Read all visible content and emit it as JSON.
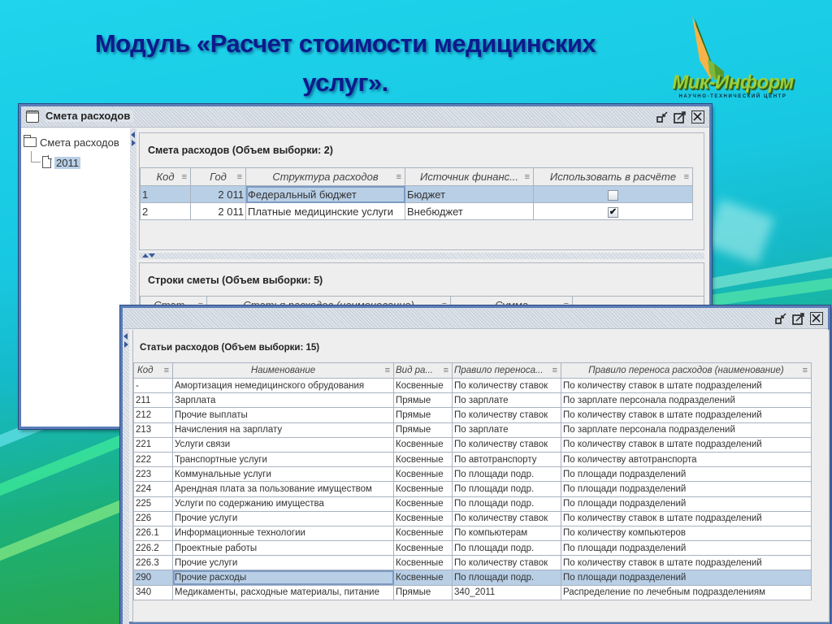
{
  "slide": {
    "title_line1": "Модуль «Расчет стоимости медицинских",
    "title_line2": "услуг».",
    "logo_name": "Мик-Информ",
    "logo_tagline": "НАУЧНО-ТЕХНИЧЕСКИЙ ЦЕНТР"
  },
  "window1": {
    "title": "Смета расходов",
    "tree": {
      "root": "Смета расходов",
      "child": "2011"
    },
    "panel1": {
      "title": "Смета расходов (Объем выборки: 2)",
      "columns": [
        "Код",
        "Год",
        "Структура расходов",
        "Источник финанс...",
        "Использовать в расчёте"
      ],
      "rows": [
        {
          "code": "1",
          "year": "2 011",
          "structure": "Федеральный бюджет",
          "source": "Бюджет",
          "use": false
        },
        {
          "code": "2",
          "year": "2 011",
          "structure": "Платные медицинские услуги",
          "source": "Внебюджет",
          "use": true
        }
      ],
      "selected_row": 0
    },
    "panel2": {
      "title": "Строки сметы (Объем выборки: 5)",
      "columns": [
        "Стат...",
        "Статья расходов (наименование)",
        "Сумма",
        ""
      ]
    }
  },
  "window2": {
    "panel": {
      "title": "Статьи расходов (Объем выборки: 15)",
      "columns": [
        "Код",
        "Наименование",
        "Вид ра...",
        "Правило переноса...",
        "Правило переноса расходов (наименование)"
      ],
      "rows": [
        [
          "-",
          "Амортизация немедицинского обрудования",
          "Косвенные",
          "По количеству ставок",
          "По количеству ставок в штате подразделений"
        ],
        [
          "211",
          "Зарплата",
          "Прямые",
          "По зарплате",
          "По зарплате персонала подразделений"
        ],
        [
          "212",
          "Прочие выплаты",
          "Прямые",
          "По количеству ставок",
          "По количеству ставок в штате подразделений"
        ],
        [
          "213",
          "Начисления на зарплату",
          "Прямые",
          "По зарплате",
          "По зарплате персонала подразделений"
        ],
        [
          "221",
          "Услуги связи",
          "Косвенные",
          "По количеству ставок",
          "По количеству ставок в штате подразделений"
        ],
        [
          "222",
          "Транспортные услуги",
          "Косвенные",
          "По автотранспорту",
          "По количеству автотранспорта"
        ],
        [
          "223",
          "Коммунальные услуги",
          "Косвенные",
          "По площади подр.",
          "По площади подразделений"
        ],
        [
          "224",
          "Арендная плата за пользование имуществом",
          "Косвенные",
          "По площади подр.",
          "По площади подразделений"
        ],
        [
          "225",
          "Услуги по содержанию имущества",
          "Косвенные",
          "По площади подр.",
          "По площади подразделений"
        ],
        [
          "226",
          "Прочие услуги",
          "Косвенные",
          "По количеству ставок",
          "По количеству ставок в штате подразделений"
        ],
        [
          "226.1",
          "Информационные технологии",
          "Косвенные",
          "По компьютерам",
          "По количеству компьютеров"
        ],
        [
          "226.2",
          "Проектные работы",
          "Косвенные",
          "По площади подр.",
          "По площади подразделений"
        ],
        [
          "226.3",
          "Прочие услуги",
          "Косвенные",
          "По количеству ставок",
          "По количеству ставок в штате подразделений"
        ],
        [
          "290",
          "Прочие расходы",
          "Косвенные",
          "По площади подр.",
          "По площади подразделений"
        ],
        [
          "340",
          "Медикаменты, расходные материалы, питание",
          "Прямые",
          "340_2011",
          "Распределение по лечебным подразделениям"
        ]
      ],
      "selected_row": 13
    }
  },
  "icons": {
    "minimize": "minimize-icon",
    "maximize": "maximize-icon",
    "close": "close-icon",
    "column_menu": "≡"
  },
  "colors": {
    "title_text": "#0d1a8c",
    "window_border": "#5a7db8",
    "selection": "#b8cfe6",
    "logo_green": "#9bcf3c",
    "logo_orange": "#f5b34a"
  }
}
